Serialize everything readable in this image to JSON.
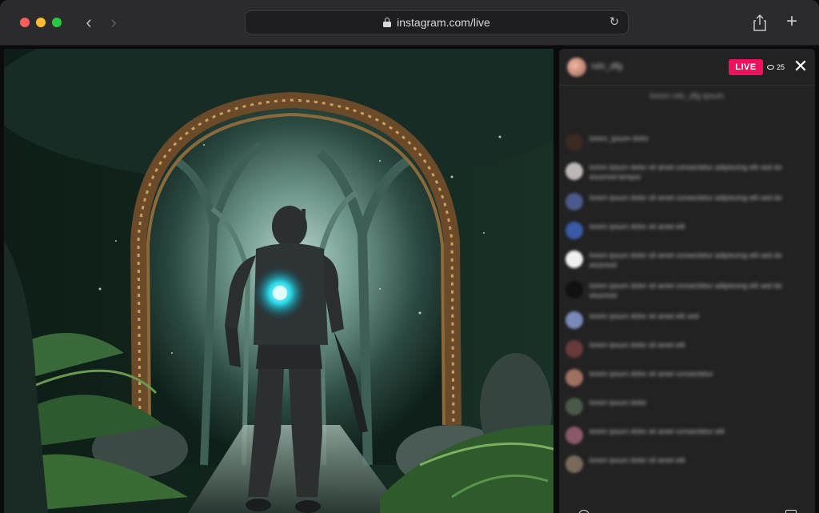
{
  "browser": {
    "url": "instagram.com/live",
    "back_icon": "chevron-left-icon",
    "forward_icon": "chevron-right-icon",
    "reload_icon": "reload-icon",
    "share_icon": "share-icon",
    "new_tab_icon": "plus-icon"
  },
  "live": {
    "badge": "LIVE",
    "viewer_count": "25",
    "close_icon": "close-icon",
    "badge_color": "#ee1160"
  },
  "comments_icon_colors": [
    "#3a2a22",
    "#bdb7b7",
    "#4a5a8a",
    "#3a5aa8",
    "#f0f0f0",
    "#111111",
    "#7a8ab8",
    "#6a3a3a",
    "#a07060",
    "#4a5a4a",
    "#8a5a6a",
    "#7a6a5a"
  ]
}
